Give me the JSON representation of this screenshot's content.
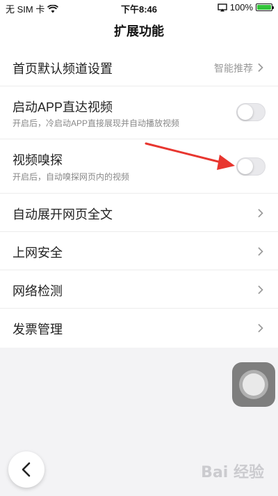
{
  "status_bar": {
    "carrier": "无 SIM 卡",
    "time": "下午8:46",
    "battery_percent": "100%",
    "battery_level": 1.0,
    "battery_color": "#33c43a",
    "icons": [
      "wifi-icon",
      "airplay-icon",
      "battery-icon"
    ]
  },
  "header": {
    "title": "扩展功能"
  },
  "settings": {
    "items": [
      {
        "title": "首页默认频道设置",
        "value": "智能推荐",
        "type": "chevron"
      },
      {
        "title": "启动APP直达视频",
        "subtitle": "开启后，冷启动APP直接展现并自动播放视频",
        "type": "toggle",
        "on": false
      },
      {
        "title": "视频嗅探",
        "subtitle": "开启后，自动嗅探网页内的视频",
        "type": "toggle",
        "on": false
      },
      {
        "title": "自动展开网页全文",
        "type": "chevron"
      },
      {
        "title": "上网安全",
        "type": "chevron"
      },
      {
        "title": "网络检测",
        "type": "chevron"
      },
      {
        "title": "发票管理",
        "type": "chevron"
      }
    ]
  },
  "annotation": {
    "arrow_color": "#e8362f"
  },
  "colors": {
    "background": "#f3f3f5",
    "toggle_off": "#e9e9ec"
  },
  "watermark": {
    "text": "Bai 经验"
  }
}
